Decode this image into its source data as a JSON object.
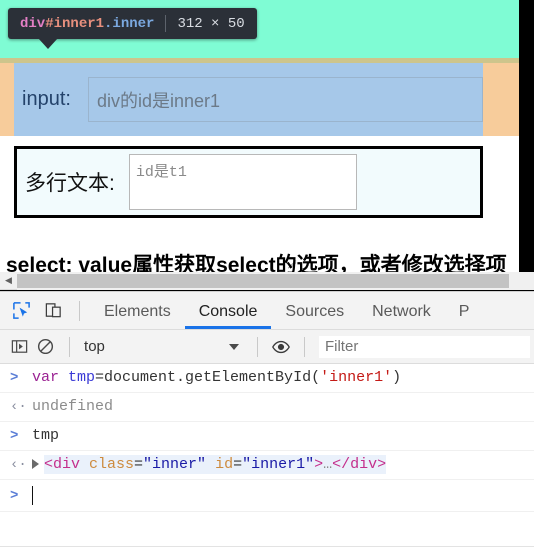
{
  "inspector_tooltip": {
    "tag": "div",
    "id": "#inner1",
    "class": ".inner",
    "dimensions": "312 × 50",
    "background_color": "#2b3038"
  },
  "page": {
    "background_color": "#7ffcd4",
    "highlight_content_color": "#a6c8e9",
    "highlight_padding_color": "#f7cc9b",
    "input_row": {
      "label": "input:",
      "value": "div的id是inner1",
      "placeholder": "div的id是inner1"
    },
    "textarea_row": {
      "label": "多行文本:",
      "value": "id是t1",
      "placeholder": "id是t1",
      "resize_handle": "resize-handle-icon"
    },
    "select_caption": "select: value属性获取select的选项，或者修改选择项"
  },
  "scrollbar": {
    "left_arrow": "chevron-left-icon"
  },
  "devtools": {
    "toolbar": {
      "inspect_icon": "inspect-element-icon",
      "device_toggle_icon": "device-toolbar-icon"
    },
    "tabs": [
      {
        "label": "Elements",
        "active": false
      },
      {
        "label": "Console",
        "active": true
      },
      {
        "label": "Sources",
        "active": false
      },
      {
        "label": "Network",
        "active": false
      },
      {
        "label": "P",
        "active": false
      }
    ],
    "active_tab_accent": "#1a73e8",
    "console_toolbar": {
      "sidebar_icon": "console-sidebar-icon",
      "clear_icon": "clear-console-icon",
      "context": "top",
      "context_caret": "chevron-down-icon",
      "eye_icon": "live-expression-icon",
      "filter_placeholder": "Filter"
    },
    "console_rows": [
      {
        "kind": "input",
        "gutter": ">",
        "tokens": [
          {
            "text": "var ",
            "cls": "tok-kw"
          },
          {
            "text": "tmp",
            "cls": "tok-var"
          },
          {
            "text": "=document.getElementById(",
            "cls": "tok-plain"
          },
          {
            "text": "'inner1'",
            "cls": "tok-str"
          },
          {
            "text": ")",
            "cls": "tok-plain"
          }
        ]
      },
      {
        "kind": "output",
        "gutter": "‹·",
        "tokens": [
          {
            "text": "undefined",
            "cls": "tok-gray"
          }
        ]
      },
      {
        "kind": "input",
        "gutter": ">",
        "tokens": [
          {
            "text": "tmp",
            "cls": "tok-plain"
          }
        ]
      },
      {
        "kind": "output-dom",
        "gutter": "‹·",
        "expander": "expand-triangle-icon",
        "tokens": [
          {
            "text": "<div",
            "cls": "tok-tag"
          },
          {
            "text": " class",
            "cls": "tok-attr"
          },
          {
            "text": "=",
            "cls": "tok-plain"
          },
          {
            "text": "\"inner\"",
            "cls": "tok-val"
          },
          {
            "text": " id",
            "cls": "tok-attr"
          },
          {
            "text": "=",
            "cls": "tok-plain"
          },
          {
            "text": "\"inner1\"",
            "cls": "tok-val"
          },
          {
            "text": ">",
            "cls": "tok-tag"
          },
          {
            "text": "…",
            "cls": "tok-gray"
          },
          {
            "text": "</div>",
            "cls": "tok-tag"
          }
        ]
      }
    ],
    "prompt": {
      "gutter": ">",
      "value": ""
    }
  }
}
